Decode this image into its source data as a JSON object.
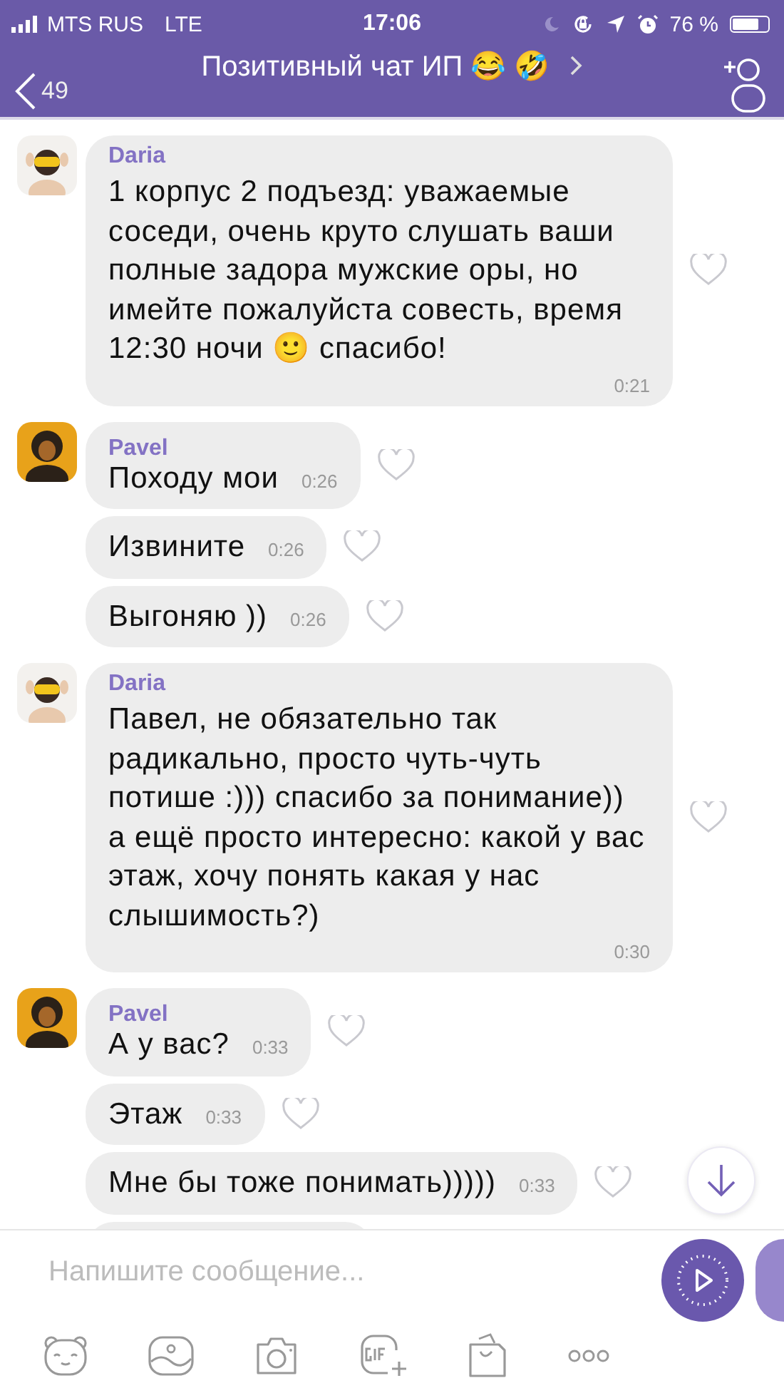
{
  "status_bar": {
    "carrier": "MTS RUS",
    "network": "LTE",
    "time": "17:06",
    "battery": "76 %"
  },
  "header": {
    "back_count": "49",
    "title": "Позитивный чат ИП 😂 🤣"
  },
  "groups": [
    {
      "sender": "Daria",
      "avatar": {
        "kind": "picture"
      },
      "messages": [
        {
          "kind": "block",
          "text": "1 корпус 2 подъезд: уважаемые соседи, очень круто слушать ваши полные задора мужские оры, но имейте пожалуйста совесть, время 12:30 ночи 🙂 спасибо!",
          "time": "0:21"
        }
      ]
    },
    {
      "sender": "Pavel",
      "avatar": {
        "kind": "picture"
      },
      "messages": [
        {
          "kind": "inline",
          "text": "Походу мои",
          "time": "0:26"
        },
        {
          "kind": "inline",
          "text": "Извините",
          "time": "0:26"
        },
        {
          "kind": "inline",
          "text": "Выгоняю ))",
          "time": "0:26"
        }
      ]
    },
    {
      "sender": "Daria",
      "avatar": {
        "kind": "picture"
      },
      "messages": [
        {
          "kind": "block",
          "text": "Павел, не обязательно так радикально, просто чуть-чуть потише :))) спасибо за понимание)) а ещё просто интересно: какой у вас этаж, хочу понять какая у нас слышимость?)",
          "time": "0:30"
        }
      ]
    },
    {
      "sender": "Pavel",
      "avatar": {
        "kind": "picture"
      },
      "messages": [
        {
          "kind": "inline",
          "text": "А у вас?",
          "time": "0:33"
        },
        {
          "kind": "inline",
          "text": "Этаж",
          "time": "0:33"
        },
        {
          "kind": "inline",
          "text": "Мне бы тоже понимать)))))",
          "time": "0:33"
        },
        {
          "kind": "partial"
        }
      ]
    }
  ],
  "composer": {
    "placeholder": "Напишите сообщение..."
  }
}
